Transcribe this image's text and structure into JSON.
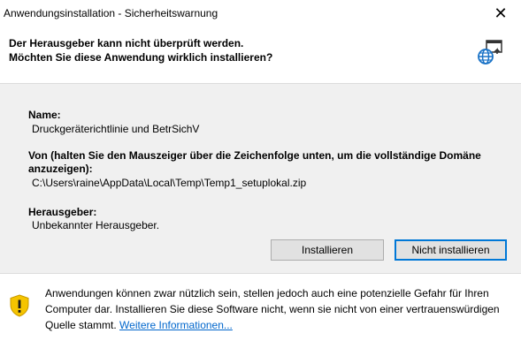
{
  "window": {
    "title": "Anwendungsinstallation - Sicherheitswarnung",
    "close_glyph": "✕"
  },
  "header": {
    "line1": "Der Herausgeber kann nicht überprüft werden.",
    "line2": "Möchten Sie diese Anwendung wirklich installieren?",
    "icon": "application-install-globe-icon"
  },
  "details": {
    "name_label": "Name:",
    "name_value": "Druckgeräterichtlinie und BetrSichV",
    "from_label_line1": "Von (halten Sie den Mauszeiger über die Zeichenfolge unten, um die vollständige Domäne",
    "from_label_line2": "anzuzeigen):",
    "from_value": "C:\\Users\\raine\\AppData\\Local\\Temp\\Temp1_setuplokal.zip",
    "publisher_label": "Herausgeber:",
    "publisher_value": "Unbekannter Herausgeber."
  },
  "buttons": {
    "install": "Installieren",
    "dont_install": "Nicht installieren"
  },
  "footer": {
    "warning_icon": "shield-warning-icon",
    "text": "Anwendungen können zwar nützlich sein, stellen jedoch auch eine potenzielle Gefahr für Ihren Computer dar. Installieren Sie diese Software nicht, wenn sie nicht von einer vertrauenswürdigen Quelle stammt.",
    "link": "Weitere Informationen..."
  },
  "colors": {
    "accent": "#0078d7",
    "link": "#0066cc",
    "shield_yellow": "#f5c400"
  }
}
